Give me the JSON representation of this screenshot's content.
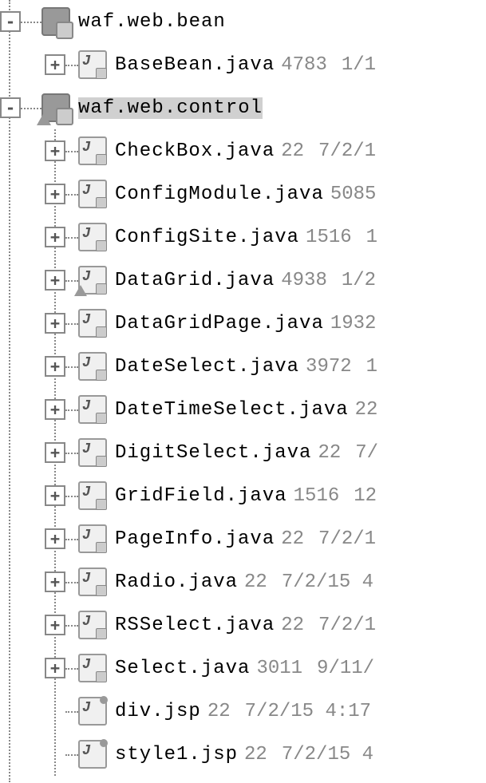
{
  "tree": {
    "nodes": [
      {
        "type": "package-star",
        "label": "waf.web.bean",
        "rev": "",
        "date": "",
        "expander": "-",
        "level": 0,
        "selected": false
      },
      {
        "type": "java-star",
        "label": "BaseBean.java",
        "rev": "4783",
        "date": "1/1",
        "expander": "+",
        "level": 1,
        "selected": false
      },
      {
        "type": "package-warn",
        "label": "waf.web.control",
        "rev": "",
        "date": "",
        "expander": "-",
        "level": 0,
        "selected": true
      },
      {
        "type": "java",
        "label": "CheckBox.java",
        "rev": "22",
        "date": "7/2/1",
        "expander": "+",
        "level": 1,
        "selected": false
      },
      {
        "type": "java",
        "label": "ConfigModule.java",
        "rev": "5085",
        "date": "",
        "expander": "+",
        "level": 1,
        "selected": false
      },
      {
        "type": "java",
        "label": "ConfigSite.java",
        "rev": "1516",
        "date": "1",
        "expander": "+",
        "level": 1,
        "selected": false
      },
      {
        "type": "java-warn",
        "label": "DataGrid.java",
        "rev": "4938",
        "date": "1/2",
        "expander": "+",
        "level": 1,
        "selected": false
      },
      {
        "type": "java",
        "label": "DataGridPage.java",
        "rev": "1932",
        "date": "",
        "expander": "+",
        "level": 1,
        "selected": false
      },
      {
        "type": "java",
        "label": "DateSelect.java",
        "rev": "3972",
        "date": "1",
        "expander": "+",
        "level": 1,
        "selected": false
      },
      {
        "type": "java",
        "label": "DateTimeSelect.java",
        "rev": "22",
        "date": "",
        "expander": "+",
        "level": 1,
        "selected": false
      },
      {
        "type": "java",
        "label": "DigitSelect.java",
        "rev": "22",
        "date": "7/",
        "expander": "+",
        "level": 1,
        "selected": false
      },
      {
        "type": "java",
        "label": "GridField.java",
        "rev": "1516",
        "date": "12",
        "expander": "+",
        "level": 1,
        "selected": false
      },
      {
        "type": "java",
        "label": "PageInfo.java",
        "rev": "22",
        "date": "7/2/1",
        "expander": "+",
        "level": 1,
        "selected": false
      },
      {
        "type": "java",
        "label": "Radio.java",
        "rev": "22",
        "date": "7/2/15 4",
        "expander": "+",
        "level": 1,
        "selected": false
      },
      {
        "type": "java",
        "label": "RSSelect.java",
        "rev": "22",
        "date": "7/2/1",
        "expander": "+",
        "level": 1,
        "selected": false
      },
      {
        "type": "java",
        "label": "Select.java",
        "rev": "3011",
        "date": "9/11/",
        "expander": "+",
        "level": 1,
        "selected": false
      },
      {
        "type": "jsp",
        "label": "div.jsp",
        "rev": "22",
        "date": "7/2/15 4:17",
        "expander": "",
        "level": 1,
        "selected": false
      },
      {
        "type": "jsp",
        "label": "style1.jsp",
        "rev": "22",
        "date": "7/2/15 4",
        "expander": "",
        "level": 1,
        "selected": false
      }
    ]
  },
  "symbols": {
    "plus": "+",
    "minus": "-"
  }
}
